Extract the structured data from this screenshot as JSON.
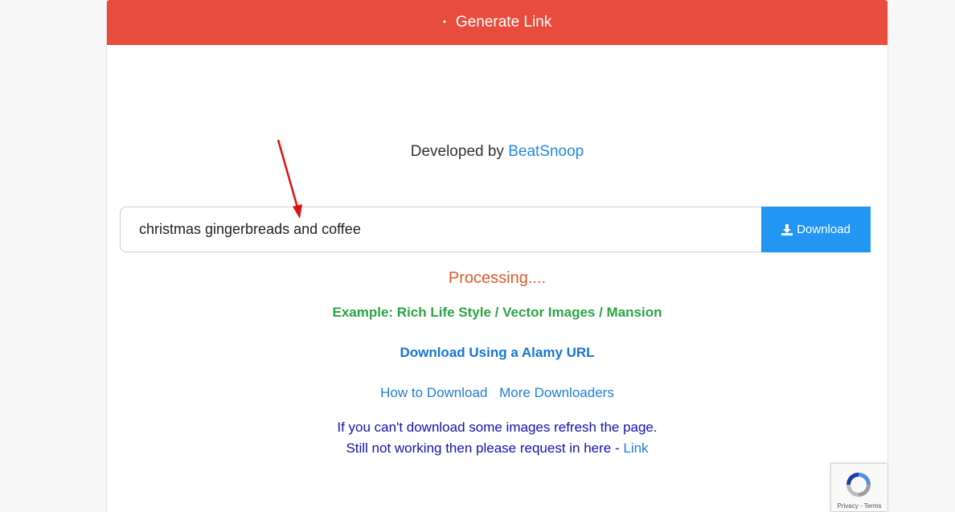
{
  "header": {
    "title": "Generate Link",
    "bullet": "•"
  },
  "developer": {
    "prefix": "Developed by",
    "brand": "BeatSnoop"
  },
  "search": {
    "value": "christmas gingerbreads and coffee",
    "button_label": "Download"
  },
  "status": {
    "processing": "Processing...."
  },
  "example": {
    "text": "Example: Rich Life Style / Vector Images / Mansion"
  },
  "alamy_link": {
    "text": "Download Using a Alamy URL"
  },
  "nav_links": [
    {
      "label": "How to Download"
    },
    {
      "label": "More Downloaders"
    }
  ],
  "note": {
    "line1": "If you can't download some images refresh the page.",
    "line2": "Still not working then please request in here - ",
    "link": "Link"
  },
  "recaptcha": {
    "legal": "Privacy - Terms"
  },
  "colors": {
    "header_bg": "#e84c3d",
    "button_bg": "#2196f3",
    "processing": "#e35a2d",
    "example": "#2aa544",
    "link": "#1e7ed8",
    "annotation_arrow": "#e01010"
  }
}
